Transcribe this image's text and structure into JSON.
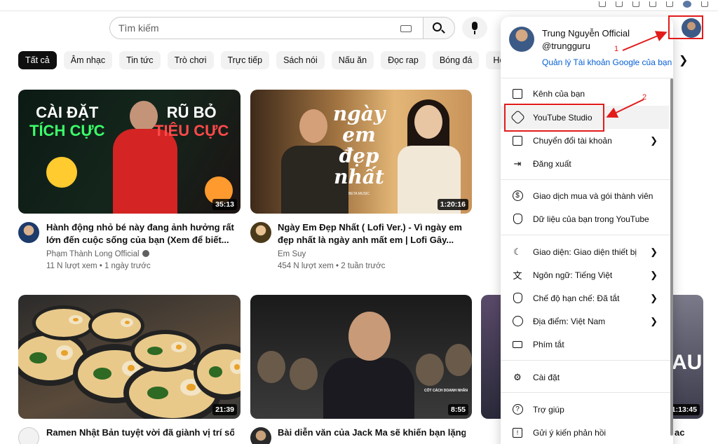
{
  "search": {
    "placeholder": "Tìm kiếm"
  },
  "chips": [
    "Tất cả",
    "Âm nhạc",
    "Tin tức",
    "Trò chơi",
    "Trực tiếp",
    "Sách nói",
    "Nấu ăn",
    "Đọc rap",
    "Bóng đá",
    "Hoạt hình"
  ],
  "chips_next_icon": "chevron-right-icon",
  "videos": [
    {
      "title": "Hành động nhỏ bé này đang ảnh hưởng rất lớn đến cuộc sống của bạn (Xem để biết...",
      "channel": "Phạm Thành Long Official",
      "meta": "11 N lượt xem • 1 ngày trước",
      "duration": "35:13",
      "thumb_text_left": "CÀI ĐẶT",
      "thumb_text_left2": "TÍCH CỰC",
      "thumb_text_right": "RŨ BỎ",
      "thumb_text_right2": "TIÊU CỰC"
    },
    {
      "title": "Ngày Em Đẹp Nhất ( Lofi Ver.) - Vì ngày em đẹp nhất là ngày anh mất em | Lofi Gây...",
      "channel": "Em Suy",
      "meta": "454 N lượt xem • 2 tuần trước",
      "duration": "1:20:16",
      "thumb_text": "ngày em đẹp nhất",
      "thumb_small": "BETA MUSIC"
    },
    {
      "title": "Ramen Nhật Bản tuyệt vời đã giành vị trí số",
      "duration": "21:39"
    },
    {
      "title": "Bài diễn văn của Jack Ma sẽ khiến bạn lặng",
      "duration": "8:55",
      "thumb_small": "CỐT CÁCH DOANH NHÂN"
    },
    {
      "duration": "1:13:45",
      "thumb_text": "AU",
      "title_fragment": "ac"
    }
  ],
  "menu": {
    "name": "Trung Nguyễn Official",
    "handle": "@trungguru",
    "manage_link": "Quản lý Tài khoản Google của bạn",
    "items": [
      {
        "label": "Kênh của bạn",
        "icon": "user-box-icon"
      },
      {
        "label": "YouTube Studio",
        "icon": "studio-icon"
      },
      {
        "label": "Chuyển đổi tài khoản",
        "icon": "switch-account-icon",
        "chevron": true
      },
      {
        "label": "Đăng xuất",
        "icon": "sign-out-icon"
      },
      {
        "label": "Giao dịch mua và gói thành viên",
        "icon": "dollar-icon"
      },
      {
        "label": "Dữ liệu của bạn trong YouTube",
        "icon": "shield-user-icon"
      },
      {
        "label": "Giao diện: Giao diện thiết bị",
        "icon": "moon-icon",
        "chevron": true
      },
      {
        "label": "Ngôn ngữ: Tiếng Việt",
        "icon": "translate-icon",
        "chevron": true
      },
      {
        "label": "Chế độ hạn chế: Đã tắt",
        "icon": "restricted-icon",
        "chevron": true
      },
      {
        "label": "Địa điểm: Việt Nam",
        "icon": "globe-icon",
        "chevron": true
      },
      {
        "label": "Phím tắt",
        "icon": "keyboard-icon"
      },
      {
        "label": "Cài đặt",
        "icon": "gear-icon"
      },
      {
        "label": "Trợ giúp",
        "icon": "help-icon"
      },
      {
        "label": "Gửi ý kiến phản hồi",
        "icon": "feedback-icon"
      }
    ]
  },
  "annotations": {
    "num1": "1",
    "num2": "2",
    "color": "#e21b1b"
  },
  "colors": {
    "link": "#065fd4",
    "chip_active": "#0f0f0f",
    "chip": "#f2f2f2"
  }
}
